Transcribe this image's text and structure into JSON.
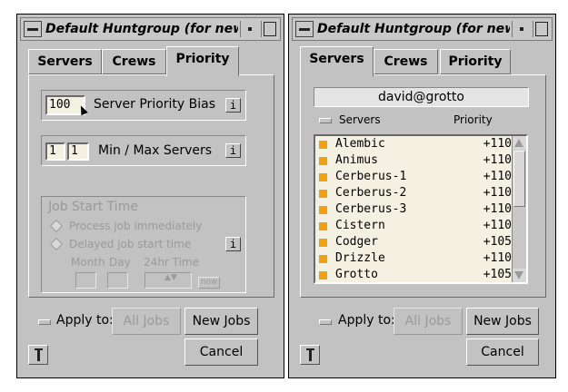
{
  "left_window": {
    "title": "Default Huntgroup (for new",
    "tabs": [
      {
        "label": "Servers",
        "active": false
      },
      {
        "label": "Crews",
        "active": false
      },
      {
        "label": "Priority",
        "active": true
      }
    ],
    "priority_bias": {
      "value": "100",
      "label": "Server Priority Bias",
      "info": "i"
    },
    "min_max": {
      "min": "1",
      "max": "1",
      "label": "Min / Max Servers",
      "info": "i"
    },
    "job_start": {
      "title": "Job Start Time",
      "option_immediate": "Process job immediately",
      "option_delayed": "Delayed job start time",
      "info": "i",
      "month_label": "Month",
      "day_label": "Day",
      "time_label": "24hr Time",
      "now_label": "now"
    },
    "apply_label": "Apply to:",
    "all_jobs_label": "All Jobs",
    "new_jobs_label": "New Jobs",
    "cancel_label": "Cancel"
  },
  "right_window": {
    "title": "Default Huntgroup (for new j",
    "tabs": [
      {
        "label": "Servers",
        "active": true
      },
      {
        "label": "Crews",
        "active": false
      },
      {
        "label": "Priority",
        "active": false
      }
    ],
    "user": "david@grotto",
    "column_servers": "Servers",
    "column_priority": "Priority",
    "servers": [
      {
        "name": "Alembic",
        "priority": "+110"
      },
      {
        "name": "Animus",
        "priority": "+110"
      },
      {
        "name": "Cerberus-1",
        "priority": "+110"
      },
      {
        "name": "Cerberus-2",
        "priority": "+110"
      },
      {
        "name": "Cerberus-3",
        "priority": "+110"
      },
      {
        "name": "Cistern",
        "priority": "+110"
      },
      {
        "name": "Codger",
        "priority": "+105"
      },
      {
        "name": "Drizzle",
        "priority": "+110"
      },
      {
        "name": "Grotto",
        "priority": "+105"
      }
    ],
    "apply_label": "Apply to:",
    "all_jobs_label": "All Jobs",
    "new_jobs_label": "New Jobs",
    "cancel_label": "Cancel"
  },
  "colors": {
    "window_bg": "#c2c2c2",
    "field_bg": "#f4f1e2",
    "server_marker": "#f0a010"
  }
}
